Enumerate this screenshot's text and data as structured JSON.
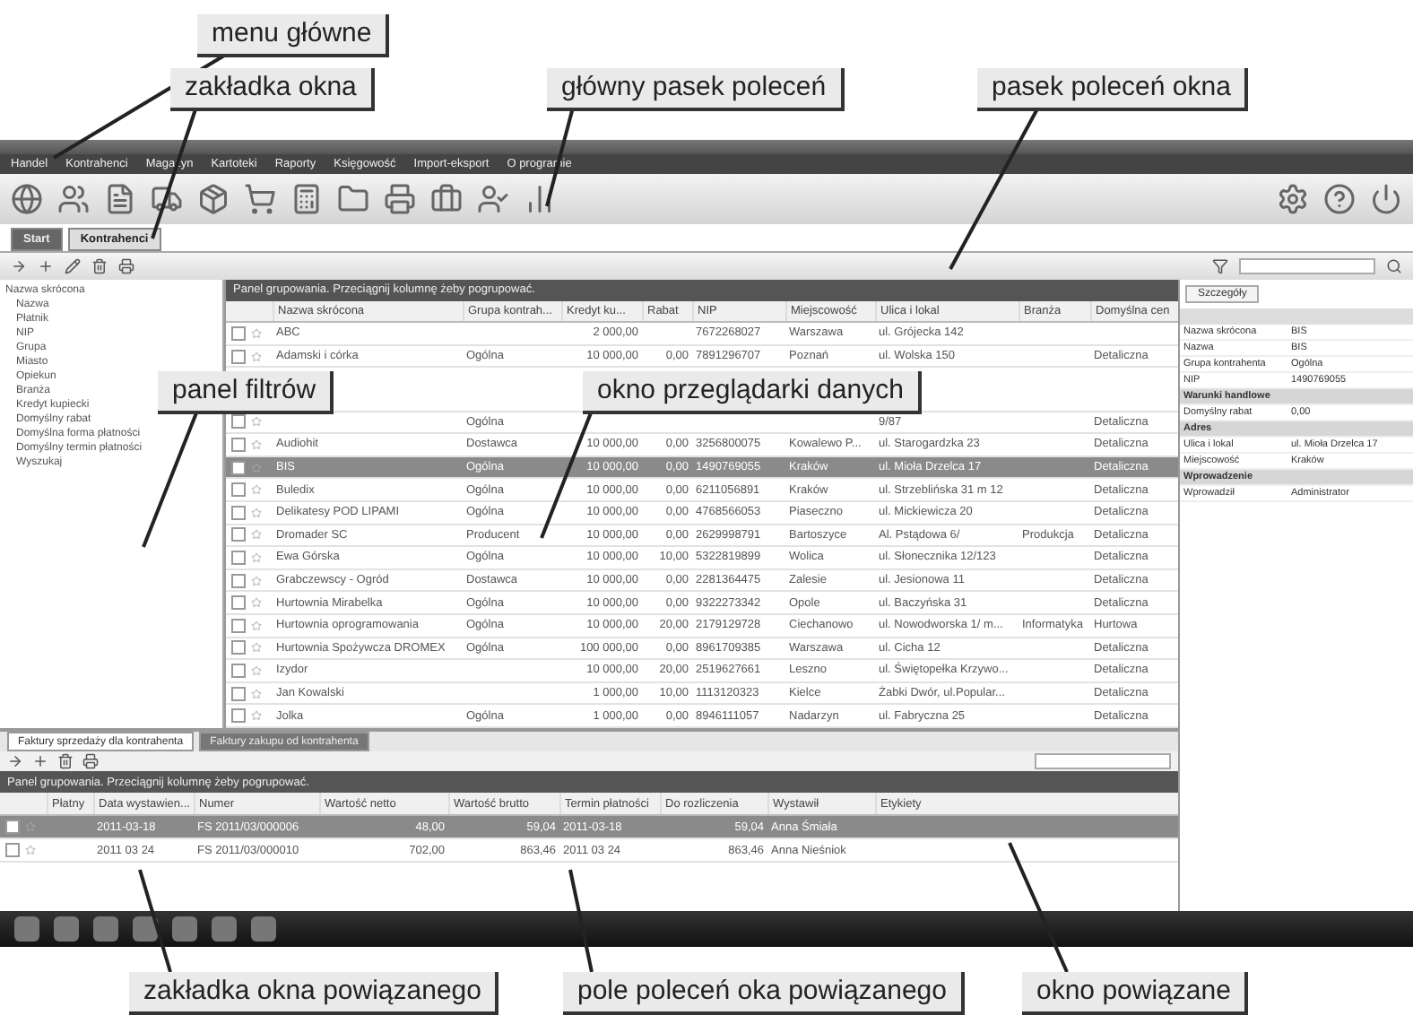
{
  "annotations": [
    {
      "text": "menu główne"
    },
    {
      "text": "zakładka okna"
    },
    {
      "text": "główny pasek poleceń"
    },
    {
      "text": "pasek poleceń okna"
    },
    {
      "text": "panel filtrów"
    },
    {
      "text": "okno przeglądarki danych"
    },
    {
      "text": "zakładka okna powiązanego"
    },
    {
      "text": "pole poleceń oka powiązanego"
    },
    {
      "text": "okno powiązane"
    }
  ],
  "menu": [
    "Handel",
    "Kontrahenci",
    "Magazyn",
    "Kartoteki",
    "Raporty",
    "Księgowość",
    "Import-eksport",
    "O programie"
  ],
  "main_tabs": [
    {
      "label": "Start",
      "selected": false
    },
    {
      "label": "Kontrahenci",
      "selected": true
    }
  ],
  "filters": [
    "Nazwa skrócona",
    "Nazwa",
    "Płatnik",
    "NIP",
    "Grupa",
    "Miasto",
    "Opiekun",
    "Branża",
    "Kredyt kupiecki",
    "Domyślny rabat",
    "Domyślna forma płatności",
    "Domyślny termin płatności",
    "Wyszukaj"
  ],
  "grid": {
    "group_panel": "Panel grupowania. Przeciągnij kolumnę żeby pogrupować.",
    "columns": [
      "Nazwa skrócona",
      "Grupa kontrah...",
      "Kredyt ku...",
      "Rabat",
      "NIP",
      "Miejscowość",
      "Ulica i lokal",
      "Branża",
      "Domyślna cen"
    ],
    "rows": [
      {
        "selected": false,
        "cells": [
          "ABC",
          "",
          "2 000,00",
          "",
          "7672268027",
          "Warszawa",
          "ul. Grójecka 142",
          "",
          ""
        ]
      },
      {
        "selected": false,
        "cells": [
          "Adamski i córka",
          "Ogólna",
          "10 000,00",
          "0,00",
          "7891296707",
          "Poznań",
          "ul. Wolska 150",
          "",
          "Detaliczna"
        ]
      },
      {
        "selected": false,
        "cells": [
          "",
          "Ogólna",
          "",
          "",
          "",
          "",
          "9/87",
          "",
          "Detaliczna"
        ]
      },
      {
        "selected": false,
        "cells": [
          "Audiohit",
          "Dostawca",
          "10 000,00",
          "0,00",
          "3256800075",
          "Kowalewo P...",
          "ul. Starogardzka 23",
          "",
          "Detaliczna"
        ]
      },
      {
        "selected": true,
        "cells": [
          "BIS",
          "Ogólna",
          "10 000,00",
          "0,00",
          "1490769055",
          "Kraków",
          "ul. Mioła Drzelca 17",
          "",
          "Detaliczna"
        ]
      },
      {
        "selected": false,
        "cells": [
          "Buledix",
          "Ogólna",
          "10 000,00",
          "0,00",
          "6211056891",
          "Kraków",
          "ul. Strzeblińska 31 m 12",
          "",
          "Detaliczna"
        ]
      },
      {
        "selected": false,
        "cells": [
          "Delikatesy POD LIPAMI",
          "Ogólna",
          "10 000,00",
          "0,00",
          "4768566053",
          "Piaseczno",
          "ul. Mickiewicza 20",
          "",
          "Detaliczna"
        ]
      },
      {
        "selected": false,
        "cells": [
          "Dromader SC",
          "Producent",
          "10 000,00",
          "0,00",
          "2629998791",
          "Bartoszyce",
          "Al. Pstądowa 6/",
          "Produkcja",
          "Detaliczna"
        ]
      },
      {
        "selected": false,
        "cells": [
          "Ewa Górska",
          "Ogólna",
          "10 000,00",
          "10,00",
          "5322819899",
          "Wolica",
          "ul. Słonecznika 12/123",
          "",
          "Detaliczna"
        ]
      },
      {
        "selected": false,
        "cells": [
          "Grabczewscy - Ogród",
          "Dostawca",
          "10 000,00",
          "0,00",
          "2281364475",
          "Zalesie",
          "ul. Jesionowa 11",
          "",
          "Detaliczna"
        ]
      },
      {
        "selected": false,
        "cells": [
          "Hurtownia Mirabelka",
          "Ogólna",
          "10 000,00",
          "0,00",
          "9322273342",
          "Opole",
          "ul. Baczyńska 31",
          "",
          "Detaliczna"
        ]
      },
      {
        "selected": false,
        "cells": [
          "Hurtownia oprogramowania",
          "Ogólna",
          "10 000,00",
          "20,00",
          "2179129728",
          "Ciechanowo",
          "ul. Nowodworska 1/ m...",
          "Informatyka",
          "Hurtowa"
        ]
      },
      {
        "selected": false,
        "cells": [
          "Hurtownia Spożywcza DROMEX",
          "Ogólna",
          "100 000,00",
          "0,00",
          "8961709385",
          "Warszawa",
          "ul. Cicha 12",
          "",
          "Detaliczna"
        ]
      },
      {
        "selected": false,
        "cells": [
          "Izydor",
          "",
          "10 000,00",
          "20,00",
          "2519627661",
          "Leszno",
          "ul. Świętopełka Krzywo...",
          "",
          "Detaliczna"
        ]
      },
      {
        "selected": false,
        "cells": [
          "Jan Kowalski",
          "",
          "1 000,00",
          "10,00",
          "1113120323",
          "Kielce",
          "Żabki Dwór, ul.Popular...",
          "",
          "Detaliczna"
        ]
      },
      {
        "selected": false,
        "cells": [
          "Jolka",
          "Ogólna",
          "1 000,00",
          "0,00",
          "8946111057",
          "Nadarzyn",
          "ul. Fabryczna 25",
          "",
          "Detaliczna"
        ]
      }
    ]
  },
  "details": {
    "tab": "Szczegóły",
    "properties": [
      {
        "kind": "row",
        "label": "Nazwa skrócona",
        "value": "BIS"
      },
      {
        "kind": "row",
        "label": "Nazwa",
        "value": "BIS"
      },
      {
        "kind": "row",
        "label": "Grupa kontrahenta",
        "value": "Ogólna"
      },
      {
        "kind": "row",
        "label": "NIP",
        "value": "1490769055"
      },
      {
        "kind": "section",
        "label": "Warunki handlowe"
      },
      {
        "kind": "row",
        "label": "Domyślny rabat",
        "value": "0,00"
      },
      {
        "kind": "section",
        "label": "Adres"
      },
      {
        "kind": "row",
        "label": "Ulica i lokal",
        "value": "ul. Mioła Drzelca 17"
      },
      {
        "kind": "row",
        "label": "Miejscowość",
        "value": "Kraków"
      },
      {
        "kind": "section",
        "label": "Wprowadzenie"
      },
      {
        "kind": "row",
        "label": "Wprowadził",
        "value": "Administrator"
      }
    ]
  },
  "related": {
    "tabs": [
      {
        "label": "Faktury sprzedaży dla kontrahenta",
        "selected": true
      },
      {
        "label": "Faktury zakupu od kontrahenta",
        "selected": false
      }
    ],
    "group_panel": "Panel grupowania. Przeciągnij kolumnę żeby pogrupować.",
    "columns": [
      "Płatny",
      "Data wystawien...",
      "Numer",
      "Wartość netto",
      "Wartość brutto",
      "Termin płatności",
      "Do rozliczenia",
      "Wystawił",
      "Etykiety"
    ],
    "rows": [
      {
        "selected": true,
        "cells": [
          "",
          "2011-03-18",
          "FS 2011/03/000006",
          "48,00",
          "59,04",
          "2011-03-18",
          "59,04",
          "Anna Śmiała",
          ""
        ]
      },
      {
        "selected": false,
        "cells": [
          "",
          "2011 03 24",
          "FS 2011/03/000010",
          "702,00",
          "863,46",
          "2011 03 24",
          "863,46",
          "Anna Nieśniok",
          ""
        ]
      }
    ]
  }
}
